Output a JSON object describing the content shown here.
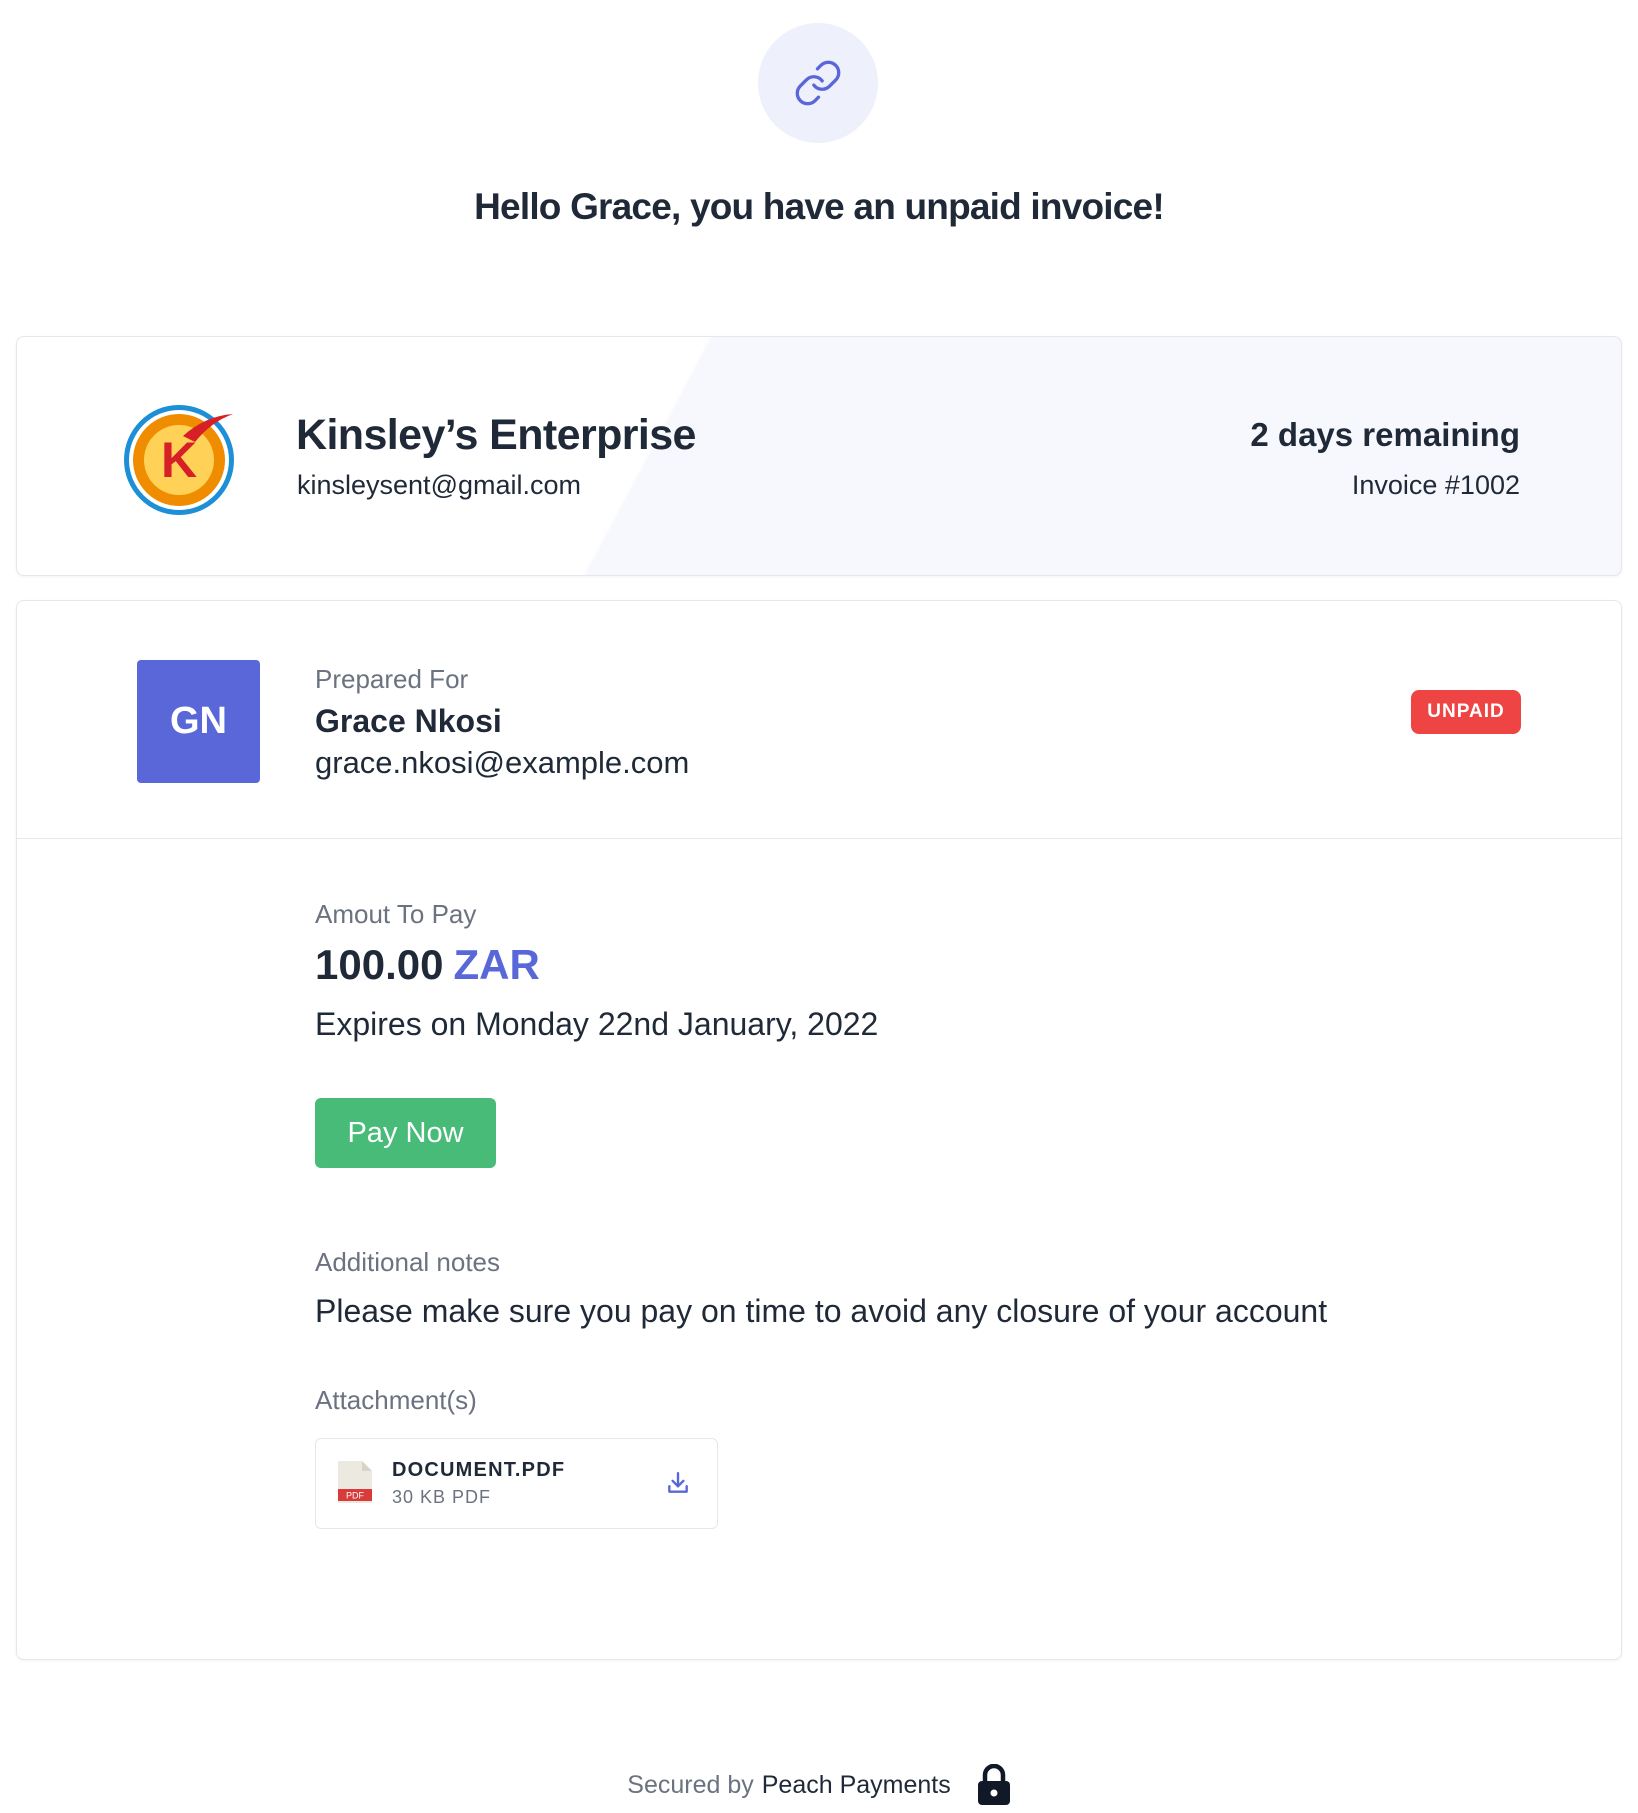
{
  "page": {
    "greeting": "Hello Grace, you have an unpaid invoice!",
    "hero_icon": "link-icon"
  },
  "merchant": {
    "name": "Kinsley’s Enterprise",
    "email": "kinsleysent@gmail.com",
    "logo_letter": "K",
    "days_remaining": "2 days remaining",
    "invoice_number": "Invoice #1002"
  },
  "client": {
    "prepared_label": "Prepared For",
    "initials": "GN",
    "name": "Grace Nkosi",
    "email": "grace.nkosi@example.com",
    "status": "UNPAID"
  },
  "payment": {
    "amount_label": "Amout To Pay",
    "amount": "100.00",
    "currency": "ZAR",
    "expires": "Expires on Monday 22nd January, 2022",
    "pay_button": "Pay Now"
  },
  "notes": {
    "label": "Additional notes",
    "text": "Please make sure you pay on time to avoid any closure of your account"
  },
  "attachments": {
    "label": "Attachment(s)",
    "items": [
      {
        "name": "DOCUMENT.PDF",
        "meta": "30 KB PDF",
        "type_badge": "PDF",
        "icon": "pdf-file-icon",
        "action_icon": "download-icon"
      }
    ]
  },
  "footer": {
    "secured_by": "Secured by",
    "brand": "Peach Payments",
    "icon": "lock-icon"
  },
  "colors": {
    "accent": "#5a67d8",
    "success": "#48bb78",
    "danger": "#ef4444",
    "text": "#1f2937",
    "muted": "#6b7280"
  }
}
